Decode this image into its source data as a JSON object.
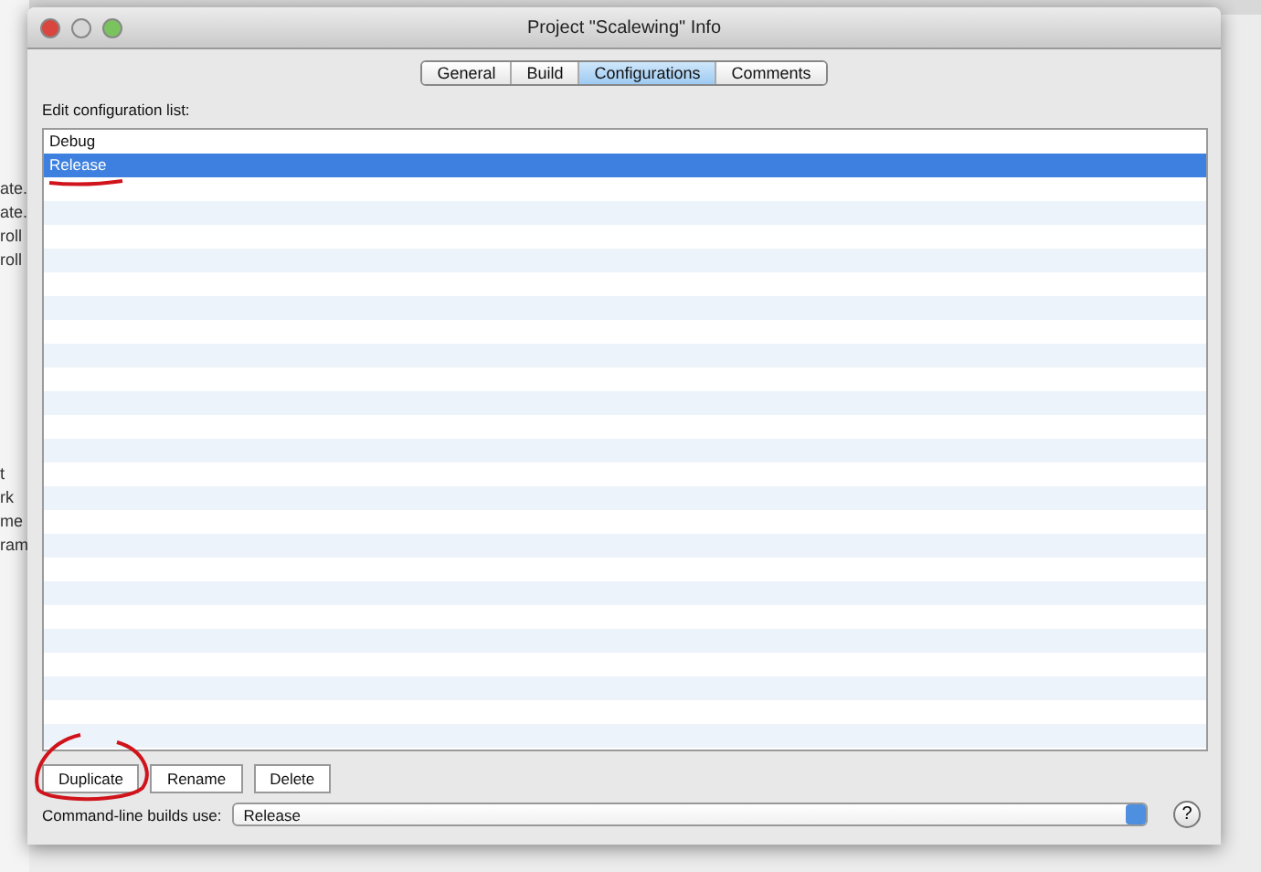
{
  "background_window": {
    "fragments": [
      "ate.",
      "ate.",
      "roll",
      "roll",
      "t",
      "rk",
      "me",
      "ram"
    ]
  },
  "window": {
    "title": "Project \"Scalewing\" Info"
  },
  "tabs": [
    {
      "label": "General",
      "selected": false
    },
    {
      "label": "Build",
      "selected": false
    },
    {
      "label": "Configurations",
      "selected": true
    },
    {
      "label": "Comments",
      "selected": false
    }
  ],
  "list_label": "Edit configuration list:",
  "configurations": [
    {
      "name": "Debug",
      "selected": false
    },
    {
      "name": "Release",
      "selected": true
    }
  ],
  "buttons": [
    "Duplicate",
    "Rename",
    "Delete"
  ],
  "command_line": {
    "label": "Command-line builds use:",
    "value": "Release"
  },
  "help_button": "?"
}
